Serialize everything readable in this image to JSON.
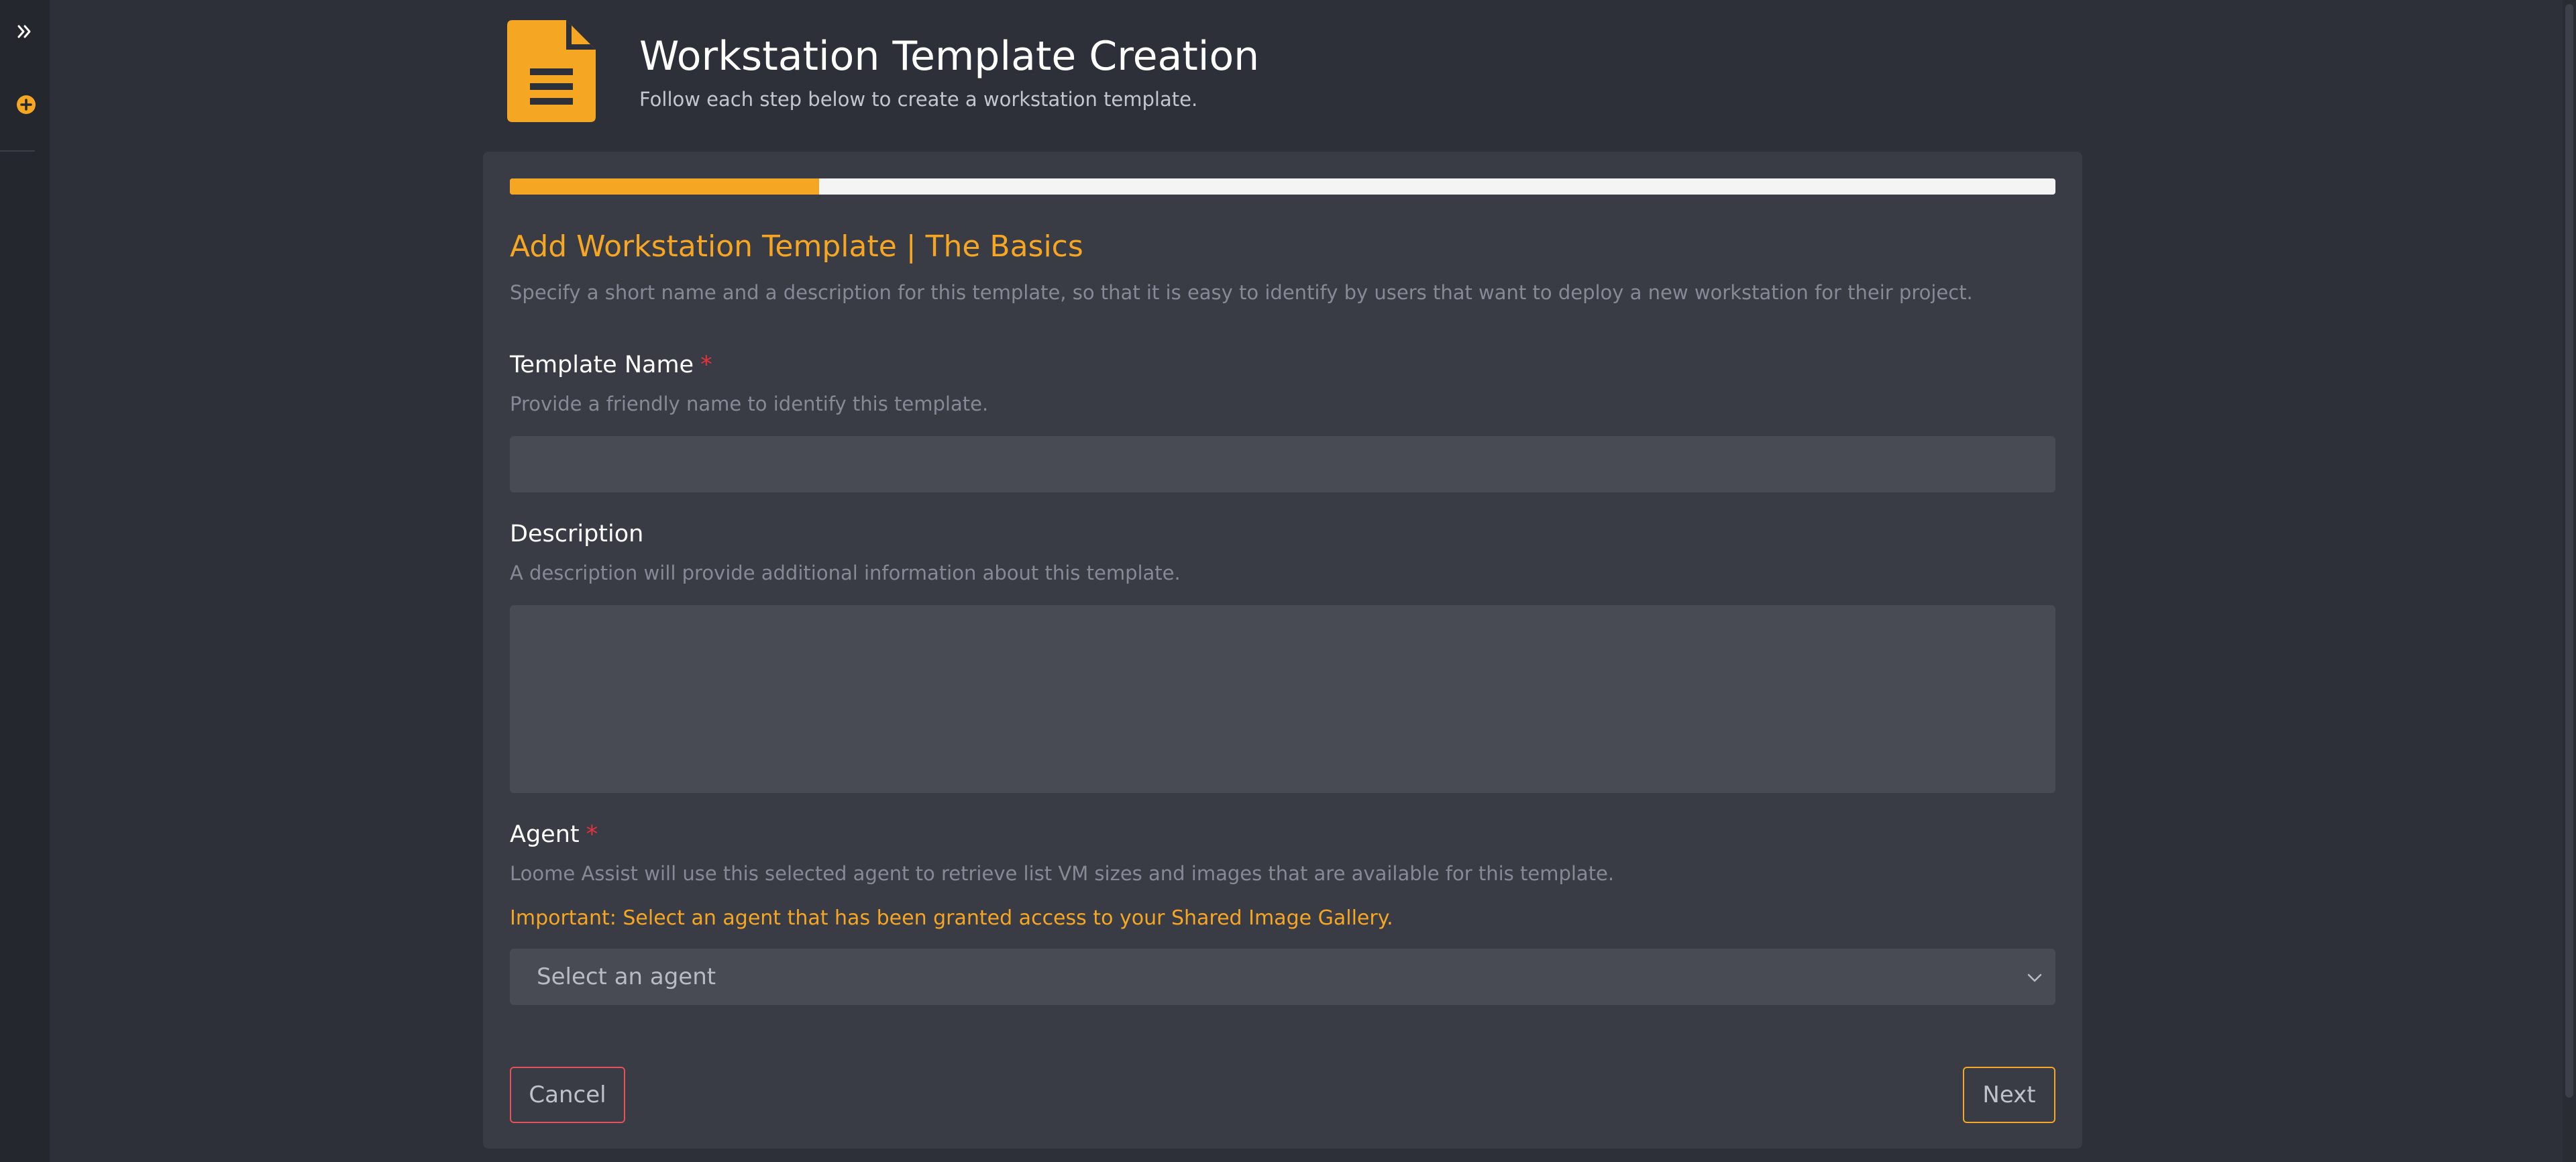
{
  "sidebar": {
    "expand_icon": "double-chevron-right-icon",
    "add_icon": "plus-circle-icon"
  },
  "header": {
    "icon": "document-icon",
    "title": "Workstation Template Creation",
    "subtitle": "Follow each step below to create a workstation template."
  },
  "wizard": {
    "progress_fraction": 0.2,
    "step_title": "Add Workstation Template | The Basics",
    "step_description": "Specify a short name and a description for this template, so that it is easy to identify by users that want to deploy a new workstation for their project."
  },
  "fields": {
    "template_name": {
      "label": "Template Name",
      "required_mark": "*",
      "help": "Provide a friendly name to identify this template.",
      "value": ""
    },
    "description": {
      "label": "Description",
      "help": "A description will provide additional information about this template.",
      "value": ""
    },
    "agent": {
      "label": "Agent",
      "required_mark": "*",
      "help": "Loome Assist will use this selected agent to retrieve list VM sizes and images that are available for this template.",
      "warning": "Important: Select an agent that has been granted access to your Shared Image Gallery.",
      "selected": "Select an agent"
    }
  },
  "actions": {
    "cancel_label": "Cancel",
    "next_label": "Next"
  },
  "colors": {
    "accent": "#f5a623",
    "danger": "#e5505a",
    "background": "#2e3039",
    "card": "#393b45"
  }
}
